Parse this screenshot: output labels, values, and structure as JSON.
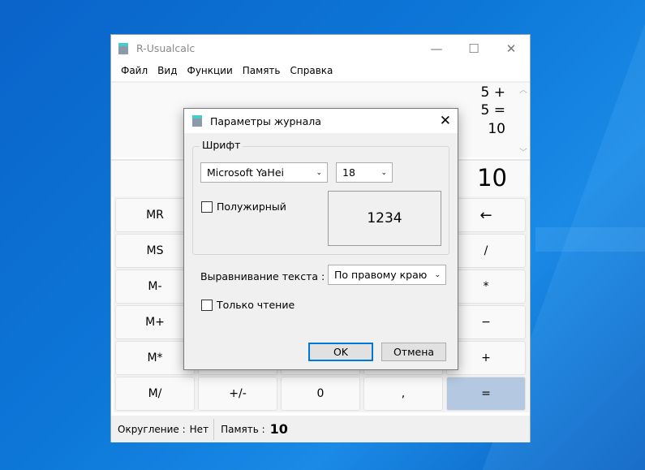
{
  "app": {
    "title": "R-Usualcalc",
    "menu": [
      "Файл",
      "Вид",
      "Функции",
      "Память",
      "Справка"
    ]
  },
  "log": {
    "lines": [
      "5 +",
      "5 =",
      "10"
    ]
  },
  "display": {
    "value": "10"
  },
  "buttons": {
    "col1": [
      "MR",
      "MS",
      "M-",
      "M+",
      "M*",
      "M/"
    ],
    "col5": [
      "←",
      "/",
      "*",
      "−",
      "+",
      "="
    ],
    "bottom": [
      "+/-",
      "0",
      ","
    ]
  },
  "status": {
    "rounding_label": "Округление :",
    "rounding_value": "Нет",
    "memory_label": "Память :",
    "memory_value": "10"
  },
  "dialog": {
    "title": "Параметры журнала",
    "font_group": "Шрифт",
    "font_name": "Microsoft YaHei",
    "font_size": "18",
    "bold_label": "Полужирный",
    "bold_checked": false,
    "preview": "1234",
    "align_label": "Выравнивание текста :",
    "align_value": "По правому краю",
    "readonly_label": "Только чтение",
    "readonly_checked": false,
    "ok": "OK",
    "cancel": "Отмена"
  },
  "colors": {
    "equals_button": "#b4c8e2",
    "accent": "#0078d7"
  }
}
